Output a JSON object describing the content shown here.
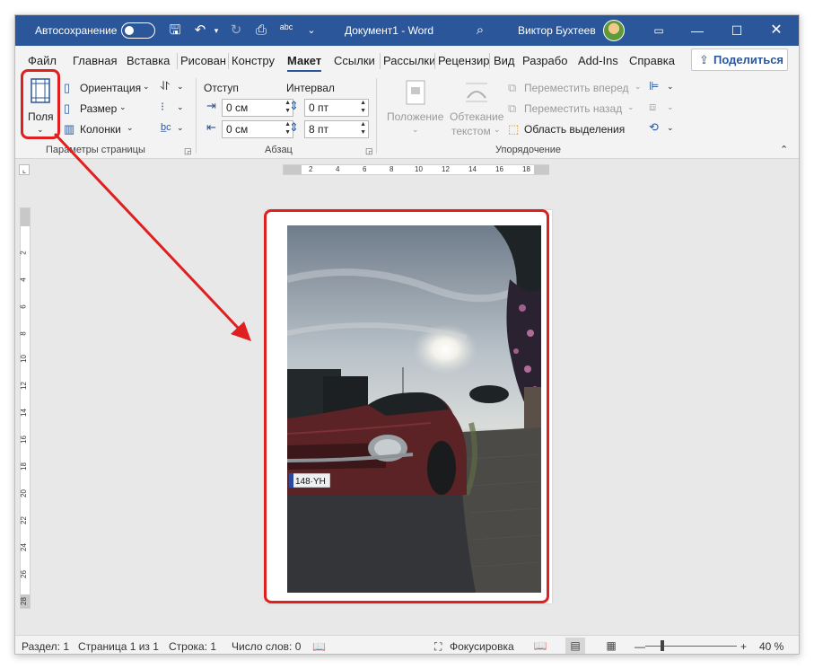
{
  "titlebar": {
    "autosave_label": "Автосохранение",
    "doc_title": "Документ1  -  Word",
    "user_name": "Виктор Бухтеев",
    "spell_label": "abc"
  },
  "tabs": [
    "Файл",
    "Главная",
    "Вставка",
    "Рисован",
    "Констру",
    "Макет",
    "Ссылки",
    "Рассылки",
    "Рецензир",
    "Вид",
    "Разрабо",
    "Add-Ins",
    "Справка"
  ],
  "active_tab": "Макет",
  "share_label": "Поделиться",
  "ribbon": {
    "page_setup": {
      "margins_label": "Поля",
      "orientation_label": "Ориентация",
      "size_label": "Размер",
      "columns_label": "Колонки",
      "group_label": "Параметры страницы"
    },
    "paragraph": {
      "indent_header": "Отступ",
      "spacing_header": "Интервал",
      "indent_left": "0 см",
      "indent_right": "0 см",
      "spacing_before": "0 пт",
      "spacing_after": "8 пт",
      "group_label": "Абзац"
    },
    "arrange": {
      "position_label": "Положение",
      "wrap_line1": "Обтекание",
      "wrap_line2": "текстом",
      "forward_label": "Переместить вперед",
      "backward_label": "Переместить назад",
      "selection_pane_label": "Область выделения",
      "group_label": "Упорядочение"
    }
  },
  "ruler": {
    "h_ticks": [
      "2",
      "4",
      "6",
      "8",
      "10",
      "12",
      "14",
      "16",
      "18"
    ],
    "v_ticks": [
      "2",
      "4",
      "6",
      "8",
      "10",
      "12",
      "14",
      "16",
      "18",
      "20",
      "22",
      "24",
      "26",
      "28"
    ]
  },
  "status": {
    "section": "Раздел: 1",
    "page": "Страница 1 из 1",
    "line": "Строка: 1",
    "words": "Число слов: 0",
    "focus": "Фокусировка",
    "zoom": "40 %"
  },
  "photo": {
    "plate": "148·YH"
  },
  "colors": {
    "word_blue": "#2b579a",
    "annotation_red": "#e02020"
  }
}
